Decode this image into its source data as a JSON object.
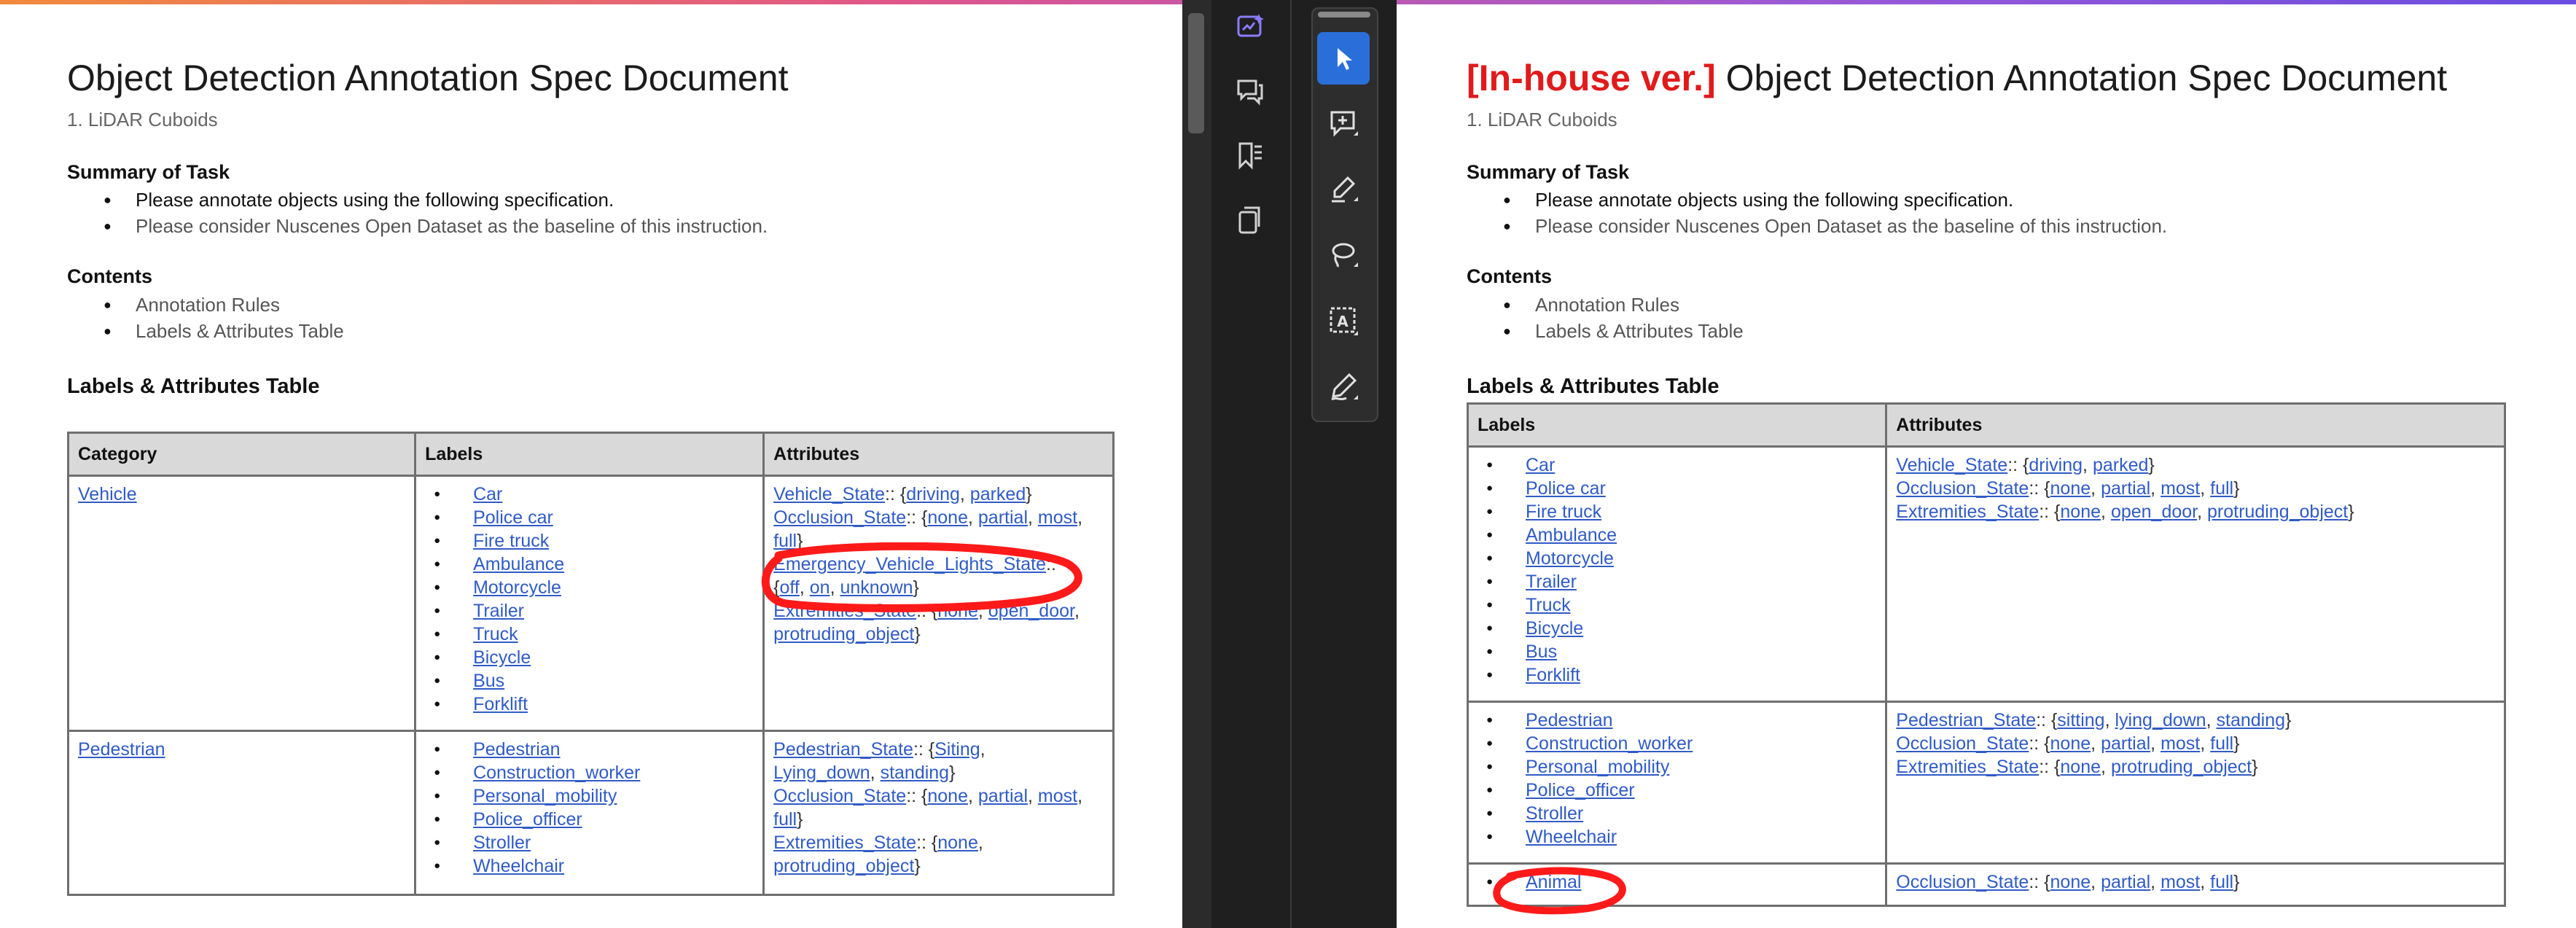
{
  "colors": {
    "accent": "#e01b1b",
    "link": "#2f5bc7",
    "active_tool": "#2a6fd9",
    "annotation": "#ff1a1a"
  },
  "left": {
    "title": "Object Detection Annotation Spec Document",
    "subtitle": "1. LiDAR Cuboids",
    "summary_heading": "Summary of Task",
    "summary_items": [
      "Please annotate objects using the following specification.",
      "Please consider Nuscenes Open Dataset as the baseline of this instruction."
    ],
    "contents_heading": "Contents",
    "contents_items": [
      "Annotation Rules",
      "Labels & Attributes Table"
    ],
    "table_heading": "Labels & Attributes Table",
    "table": {
      "headers": [
        "Category",
        "Labels",
        "Attributes"
      ],
      "rows": [
        {
          "category": "Vehicle",
          "labels": [
            "Car",
            "Police car",
            "Fire truck",
            "Ambulance",
            "Motorcycle",
            "Trailer",
            "Truck",
            "Bicycle",
            "Bus",
            "Forklift"
          ],
          "attr_lines": [
            [
              [
                "l",
                "Vehicle_State"
              ],
              [
                "t",
                ":: {"
              ],
              [
                "l",
                "driving"
              ],
              [
                "t",
                ", "
              ],
              [
                "l",
                "parked"
              ],
              [
                "t",
                "}"
              ]
            ],
            [
              [
                "l",
                "Occlusion_State"
              ],
              [
                "t",
                ":: {"
              ],
              [
                "l",
                "none"
              ],
              [
                "t",
                ", "
              ],
              [
                "l",
                "partial"
              ],
              [
                "t",
                ", "
              ],
              [
                "l",
                "most"
              ],
              [
                "t",
                ","
              ]
            ],
            [
              [
                "l",
                "full"
              ],
              [
                "t",
                "}"
              ]
            ],
            [
              [
                "l",
                "Emergency_Vehicle_Lights_State"
              ],
              [
                "t",
                "::"
              ]
            ],
            [
              [
                "t",
                "{"
              ],
              [
                "l",
                "off"
              ],
              [
                "t",
                ", "
              ],
              [
                "l",
                "on"
              ],
              [
                "t",
                ", "
              ],
              [
                "l",
                "unknown"
              ],
              [
                "t",
                "}"
              ]
            ],
            [
              [
                "l",
                "Extremities_State"
              ],
              [
                "t",
                ":: {"
              ],
              [
                "l",
                "none"
              ],
              [
                "t",
                ", "
              ],
              [
                "l",
                "open_door"
              ],
              [
                "t",
                ","
              ]
            ],
            [
              [
                "l",
                "protruding_object"
              ],
              [
                "t",
                "}"
              ]
            ]
          ]
        },
        {
          "category": "Pedestrian",
          "labels": [
            "Pedestrian",
            "Construction_worker",
            "Personal_mobility",
            "Police_officer",
            "Stroller",
            "Wheelchair"
          ],
          "attr_lines": [
            [
              [
                "l",
                "Pedestrian_State"
              ],
              [
                "t",
                ":: {"
              ],
              [
                "l",
                "Siting"
              ],
              [
                "t",
                ","
              ]
            ],
            [
              [
                "l",
                "Lying_down"
              ],
              [
                "t",
                ", "
              ],
              [
                "l",
                "standing"
              ],
              [
                "t",
                "}"
              ]
            ],
            [
              [
                "l",
                "Occlusion_State"
              ],
              [
                "t",
                ":: {"
              ],
              [
                "l",
                "none"
              ],
              [
                "t",
                ", "
              ],
              [
                "l",
                "partial"
              ],
              [
                "t",
                ", "
              ],
              [
                "l",
                "most"
              ],
              [
                "t",
                ","
              ]
            ],
            [
              [
                "l",
                "full"
              ],
              [
                "t",
                "}"
              ]
            ],
            [
              [
                "l",
                "Extremities_State"
              ],
              [
                "t",
                ":: {"
              ],
              [
                "l",
                "none"
              ],
              [
                "t",
                ","
              ]
            ],
            [
              [
                "l",
                "protruding_object"
              ],
              [
                "t",
                "}"
              ]
            ]
          ]
        }
      ]
    }
  },
  "right": {
    "title_tag": "[In-house ver.]",
    "title": " Object Detection Annotation Spec Document",
    "subtitle": "1. LiDAR Cuboids",
    "summary_heading": "Summary of Task",
    "summary_items": [
      "Please annotate objects using the following specification.",
      "Please consider Nuscenes Open Dataset as the baseline of this instruction."
    ],
    "contents_heading": "Contents",
    "contents_items": [
      "Annotation Rules",
      "Labels & Attributes Table"
    ],
    "table_heading": "Labels & Attributes Table",
    "table": {
      "headers": [
        "Labels",
        "Attributes"
      ],
      "rows": [
        {
          "labels": [
            "Car",
            "Police car",
            "Fire truck",
            "Ambulance",
            "Motorcycle",
            "Trailer",
            "Truck",
            "Bicycle",
            "Bus",
            "Forklift"
          ],
          "attr_lines": [
            [
              [
                "l",
                "Vehicle_State"
              ],
              [
                "t",
                ":: {"
              ],
              [
                "l",
                "driving"
              ],
              [
                "t",
                ", "
              ],
              [
                "l",
                "parked"
              ],
              [
                "t",
                "}"
              ]
            ],
            [
              [
                "l",
                "Occlusion_State"
              ],
              [
                "t",
                ":: {"
              ],
              [
                "l",
                "none"
              ],
              [
                "t",
                ", "
              ],
              [
                "l",
                "partial"
              ],
              [
                "t",
                ", "
              ],
              [
                "l",
                "most"
              ],
              [
                "t",
                ", "
              ],
              [
                "l",
                "full"
              ],
              [
                "t",
                "}"
              ]
            ],
            [
              [
                "l",
                "Extremities_State"
              ],
              [
                "t",
                ":: {"
              ],
              [
                "l",
                "none"
              ],
              [
                "t",
                ", "
              ],
              [
                "l",
                "open_door"
              ],
              [
                "t",
                ", "
              ],
              [
                "l",
                "protruding_object"
              ],
              [
                "t",
                "}"
              ]
            ]
          ]
        },
        {
          "labels": [
            "Pedestrian",
            "Construction_worker",
            "Personal_mobility",
            "Police_officer",
            "Stroller",
            "Wheelchair"
          ],
          "attr_lines": [
            [
              [
                "l",
                "Pedestrian_State"
              ],
              [
                "t",
                ":: {"
              ],
              [
                "l",
                "sitting"
              ],
              [
                "t",
                ", "
              ],
              [
                "l",
                "lying_down"
              ],
              [
                "t",
                ", "
              ],
              [
                "l",
                "standing"
              ],
              [
                "t",
                "}"
              ]
            ],
            [
              [
                "l",
                "Occlusion_State"
              ],
              [
                "t",
                ":: {"
              ],
              [
                "l",
                "none"
              ],
              [
                "t",
                ", "
              ],
              [
                "l",
                "partial"
              ],
              [
                "t",
                ", "
              ],
              [
                "l",
                "most"
              ],
              [
                "t",
                ", "
              ],
              [
                "l",
                "full"
              ],
              [
                "t",
                "}"
              ]
            ],
            [
              [
                "l",
                "Extremities_State"
              ],
              [
                "t",
                ":: {"
              ],
              [
                "l",
                "none"
              ],
              [
                "t",
                ", "
              ],
              [
                "l",
                "protruding_object"
              ],
              [
                "t",
                "}"
              ]
            ]
          ]
        },
        {
          "labels": [
            "Animal"
          ],
          "attr_lines": [
            [
              [
                "l",
                "Occlusion_State"
              ],
              [
                "t",
                ":: {"
              ],
              [
                "l",
                "none"
              ],
              [
                "t",
                ", "
              ],
              [
                "l",
                "partial"
              ],
              [
                "t",
                ", "
              ],
              [
                "l",
                "most"
              ],
              [
                "t",
                ", "
              ],
              [
                "l",
                "full"
              ],
              [
                "t",
                "}"
              ]
            ]
          ]
        }
      ]
    }
  },
  "rail_icons": [
    "ai-sparkle-icon",
    "comments-icon",
    "bookmarks-icon",
    "pages-icon"
  ],
  "tools": [
    "select-tool-icon",
    "add-comment-icon",
    "highlighter-icon",
    "lasso-icon",
    "text-box-icon",
    "pen-sign-icon"
  ]
}
